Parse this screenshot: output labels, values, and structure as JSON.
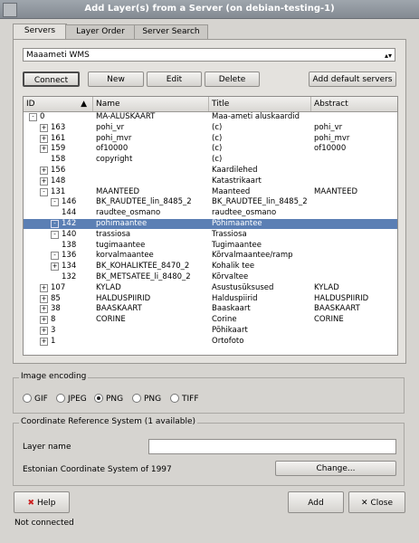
{
  "window": {
    "title": "Add Layer(s) from a Server (on debian-testing-1)"
  },
  "tabs": [
    "Servers",
    "Layer Order",
    "Server Search"
  ],
  "server_combo": {
    "value": "Maaameti WMS"
  },
  "buttons": {
    "connect": "Connect",
    "new": "New",
    "edit": "Edit",
    "delete": "Delete",
    "add_default": "Add default servers",
    "help": "Help",
    "add": "Add",
    "close": "Close",
    "change": "Change..."
  },
  "tree": {
    "columns": [
      "ID",
      "Name",
      "Title",
      "Abstract"
    ],
    "rows": [
      {
        "exp": "-",
        "id": "0",
        "name": "MA-ALUSKAART",
        "title": "Maa-ameti aluskaardid",
        "abstract": "",
        "indent": 0
      },
      {
        "exp": "+",
        "id": "163",
        "name": "pohi_vr",
        "title": "(c)",
        "abstract": "pohi_vr",
        "indent": 1
      },
      {
        "exp": "+",
        "id": "161",
        "name": "pohi_mvr",
        "title": "(c)",
        "abstract": "pohi_mvr",
        "indent": 1
      },
      {
        "exp": "+",
        "id": "159",
        "name": "of10000",
        "title": "(c)",
        "abstract": "of10000",
        "indent": 1
      },
      {
        "exp": "",
        "id": "158",
        "name": "copyright",
        "title": "(c)",
        "abstract": "",
        "indent": 1
      },
      {
        "exp": "+",
        "id": "156",
        "name": "",
        "title": "Kaardilehed",
        "abstract": "",
        "indent": 1
      },
      {
        "exp": "+",
        "id": "148",
        "name": "",
        "title": "Katastrikaart",
        "abstract": "",
        "indent": 1
      },
      {
        "exp": "-",
        "id": "131",
        "name": "MAANTEED",
        "title": "Maanteed",
        "abstract": "MAANTEED",
        "indent": 1
      },
      {
        "exp": "-",
        "id": "146",
        "name": "BK_RAUDTEE_lin_8485_2",
        "title": "BK_RAUDTEE_lin_8485_2",
        "abstract": "",
        "indent": 2
      },
      {
        "exp": "",
        "id": "144",
        "name": "raudtee_osmano",
        "title": "raudtee_osmano",
        "abstract": "",
        "indent": 2
      },
      {
        "exp": "-",
        "id": "142",
        "name": "pohimaantee",
        "title": "Põhimaantee",
        "abstract": "",
        "indent": 2,
        "sel": true
      },
      {
        "exp": "-",
        "id": "140",
        "name": "trassiosa",
        "title": "Trassiosa",
        "abstract": "",
        "indent": 2
      },
      {
        "exp": "",
        "id": "138",
        "name": "tugimaantee",
        "title": "Tugimaantee",
        "abstract": "",
        "indent": 2
      },
      {
        "exp": "-",
        "id": "136",
        "name": "korvalmaantee",
        "title": "Kõrvalmaantee/ramp",
        "abstract": "",
        "indent": 2
      },
      {
        "exp": "+",
        "id": "134",
        "name": "BK_KOHALIKTEE_8470_2",
        "title": "Kohalik tee",
        "abstract": "",
        "indent": 2
      },
      {
        "exp": "",
        "id": "132",
        "name": "BK_METSATEE_li_8480_2",
        "title": "Kõrvaltee",
        "abstract": "",
        "indent": 2
      },
      {
        "exp": "+",
        "id": "107",
        "name": "KYLAD",
        "title": "Asustusüksused",
        "abstract": "KYLAD",
        "indent": 1
      },
      {
        "exp": "+",
        "id": "85",
        "name": "HALDUSPIIRID",
        "title": "Halduspiirid",
        "abstract": "HALDUSPIIRID",
        "indent": 1
      },
      {
        "exp": "+",
        "id": "38",
        "name": "BAASKAART",
        "title": "Baaskaart",
        "abstract": "BAASKAART",
        "indent": 1
      },
      {
        "exp": "+",
        "id": "8",
        "name": "CORINE",
        "title": "Corine",
        "abstract": "CORINE",
        "indent": 1
      },
      {
        "exp": "+",
        "id": "3",
        "name": "",
        "title": "Põhikaart",
        "abstract": "",
        "indent": 1
      },
      {
        "exp": "+",
        "id": "1",
        "name": "",
        "title": "Ortofoto",
        "abstract": "",
        "indent": 1
      }
    ]
  },
  "encoding": {
    "label": "Image encoding",
    "options": [
      "GIF",
      "JPEG",
      "PNG",
      "PNG",
      "TIFF"
    ],
    "selected_index": 2
  },
  "crs": {
    "label": "Coordinate Reference System (1 available)",
    "layer_name_label": "Layer name",
    "layer_name_value": "",
    "system_text": "Estonian Coordinate System of 1997"
  },
  "status": "Not connected"
}
